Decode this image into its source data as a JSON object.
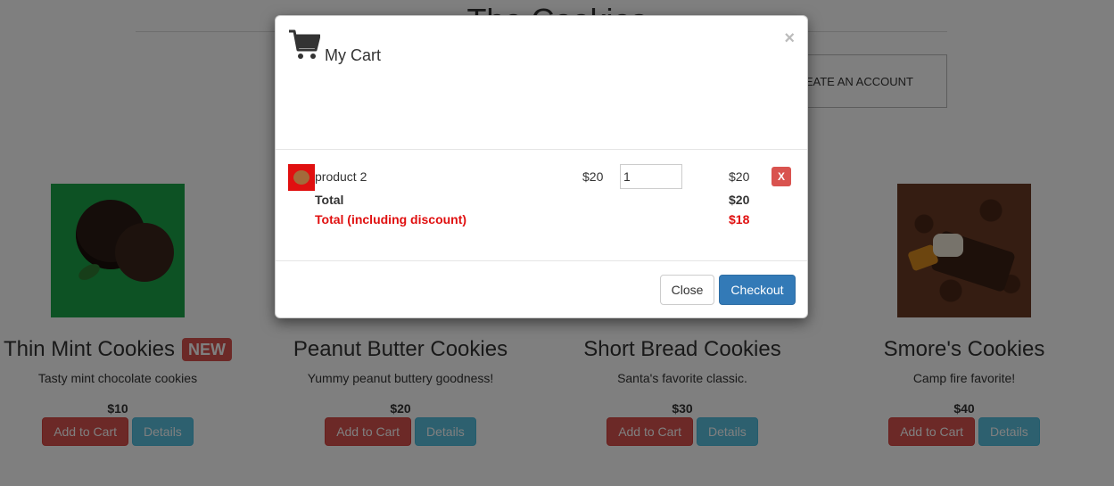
{
  "page": {
    "title": "The Cookies",
    "account_label": "CREATE AN ACCOUNT"
  },
  "products": [
    {
      "name": "Thin Mint Cookies",
      "badge": "NEW",
      "desc": "Tasty mint chocolate cookies",
      "price": "$10",
      "add_label": "Add to Cart",
      "details_label": "Details"
    },
    {
      "name": "Peanut Butter Cookies",
      "desc": "Yummy peanut buttery goodness!",
      "price": "$20",
      "add_label": "Add to Cart",
      "details_label": "Details"
    },
    {
      "name": "Short Bread Cookies",
      "desc": "Santa's favorite classic.",
      "price": "$30",
      "add_label": "Add to Cart",
      "details_label": "Details"
    },
    {
      "name": "Smore's Cookies",
      "desc": "Camp fire favorite!",
      "price": "$40",
      "add_label": "Add to Cart",
      "details_label": "Details"
    }
  ],
  "modal": {
    "icon": "shopping-cart-icon",
    "title": "My Cart",
    "close_symbol": "×",
    "item": {
      "name": "product 2",
      "price": "$20",
      "quantity": "1",
      "subtotal": "$20",
      "remove_label": "X"
    },
    "total_label": "Total",
    "total_value": "$20",
    "discount_label": "Total (including discount)",
    "discount_value": "$18",
    "close_button": "Close",
    "checkout_button": "Checkout"
  },
  "colors": {
    "danger": "#d9534f",
    "info": "#5bc0de",
    "primary": "#337ab7",
    "discount_text": "#e01010"
  }
}
